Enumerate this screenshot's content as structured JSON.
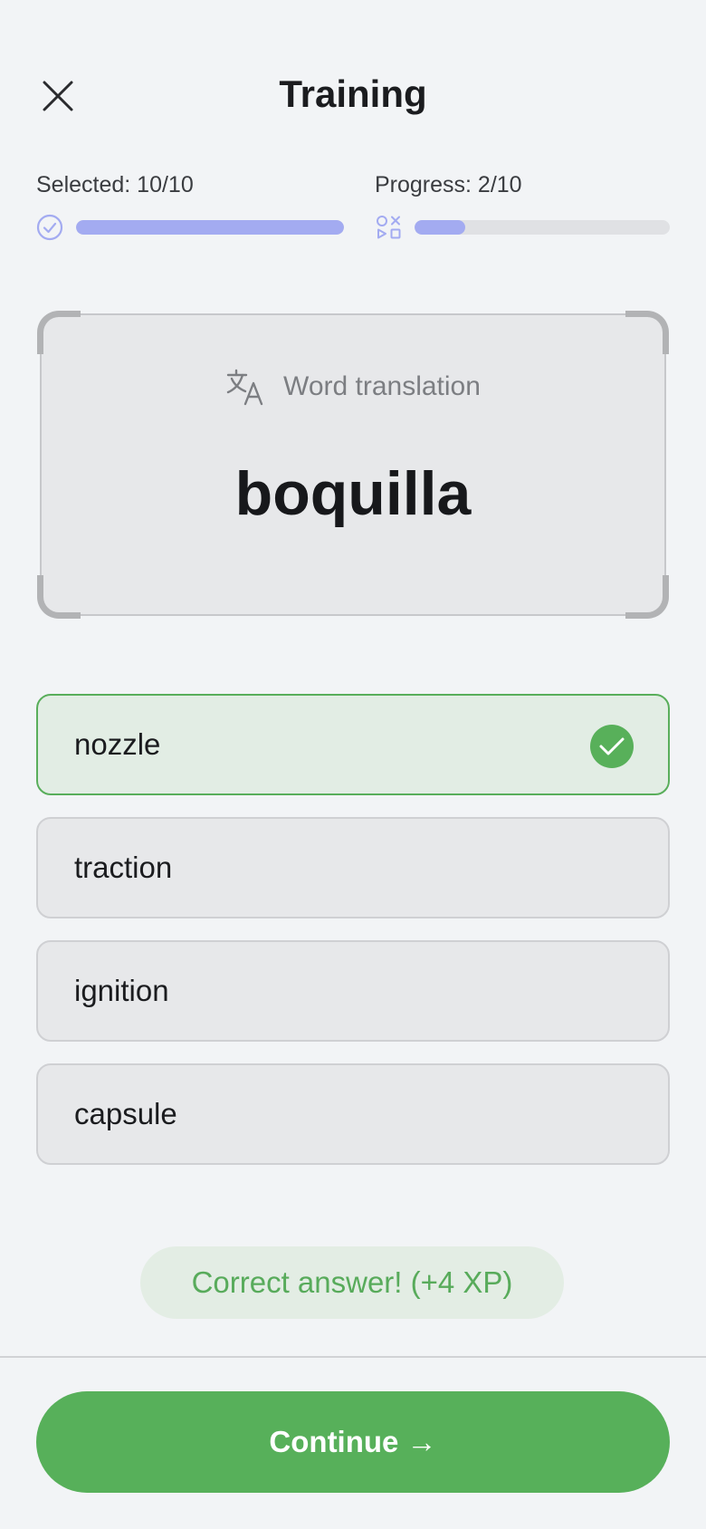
{
  "header": {
    "title": "Training",
    "close_icon": "close-icon"
  },
  "stats": {
    "selected": {
      "label": "Selected: 10/10",
      "value": 10,
      "total": 10,
      "icon": "check-circle-icon"
    },
    "progress": {
      "label": "Progress: 2/10",
      "value": 2,
      "total": 10,
      "icon": "shapes-icon"
    }
  },
  "card": {
    "type_label": "Word translation",
    "type_icon": "translate-icon",
    "word": "boquilla"
  },
  "options": [
    {
      "label": "nozzle",
      "state": "correct"
    },
    {
      "label": "traction",
      "state": "neutral"
    },
    {
      "label": "ignition",
      "state": "neutral"
    },
    {
      "label": "capsule",
      "state": "neutral"
    }
  ],
  "feedback": "Correct answer! (+4 XP)",
  "continue_label": "Continue →",
  "colors": {
    "accent": "#a3abf1",
    "success": "#58b05a",
    "background": "#f2f4f6"
  }
}
